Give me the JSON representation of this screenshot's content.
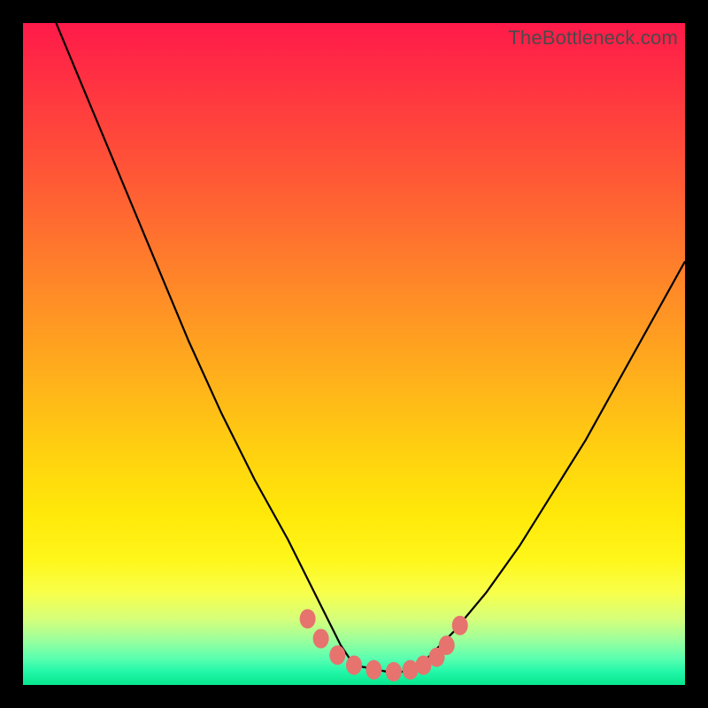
{
  "watermark": "TheBottleneck.com",
  "colors": {
    "frame": "#000000",
    "curve_stroke": "#000000",
    "marker_fill": "#e6736e",
    "marker_stroke": "#c94d4a"
  },
  "chart_data": {
    "type": "line",
    "title": "",
    "xlabel": "",
    "ylabel": "",
    "xlim": [
      0,
      100
    ],
    "ylim": [
      0,
      100
    ],
    "grid": false,
    "legend": false,
    "notes": "V-shaped bottleneck curve on a vertical rainbow gradient (red at top = high bottleneck, green at bottom = no bottleneck). The minimum (flat trough) sits roughly between x≈48 and x≈62 at y≈2–3. No axis ticks, labels, or numeric annotations are rendered; values below are estimated from pixel positions.",
    "series": [
      {
        "name": "bottleneck-curve",
        "x": [
          5,
          10,
          15,
          20,
          25,
          30,
          35,
          40,
          45,
          48,
          50,
          55,
          58,
          60,
          62,
          65,
          70,
          75,
          80,
          85,
          90,
          95,
          100
        ],
        "y": [
          100,
          88,
          76,
          64,
          52,
          41,
          31,
          22,
          12,
          6,
          3,
          2,
          2,
          3,
          5,
          8,
          14,
          21,
          29,
          37,
          46,
          55,
          64
        ]
      }
    ],
    "markers": {
      "name": "trough-markers",
      "x": [
        43,
        45,
        47.5,
        50,
        53,
        56,
        58.5,
        60.5,
        62.5,
        64,
        66
      ],
      "y": [
        10,
        7,
        4.5,
        3,
        2.3,
        2,
        2.3,
        3,
        4.2,
        6,
        9
      ]
    }
  }
}
